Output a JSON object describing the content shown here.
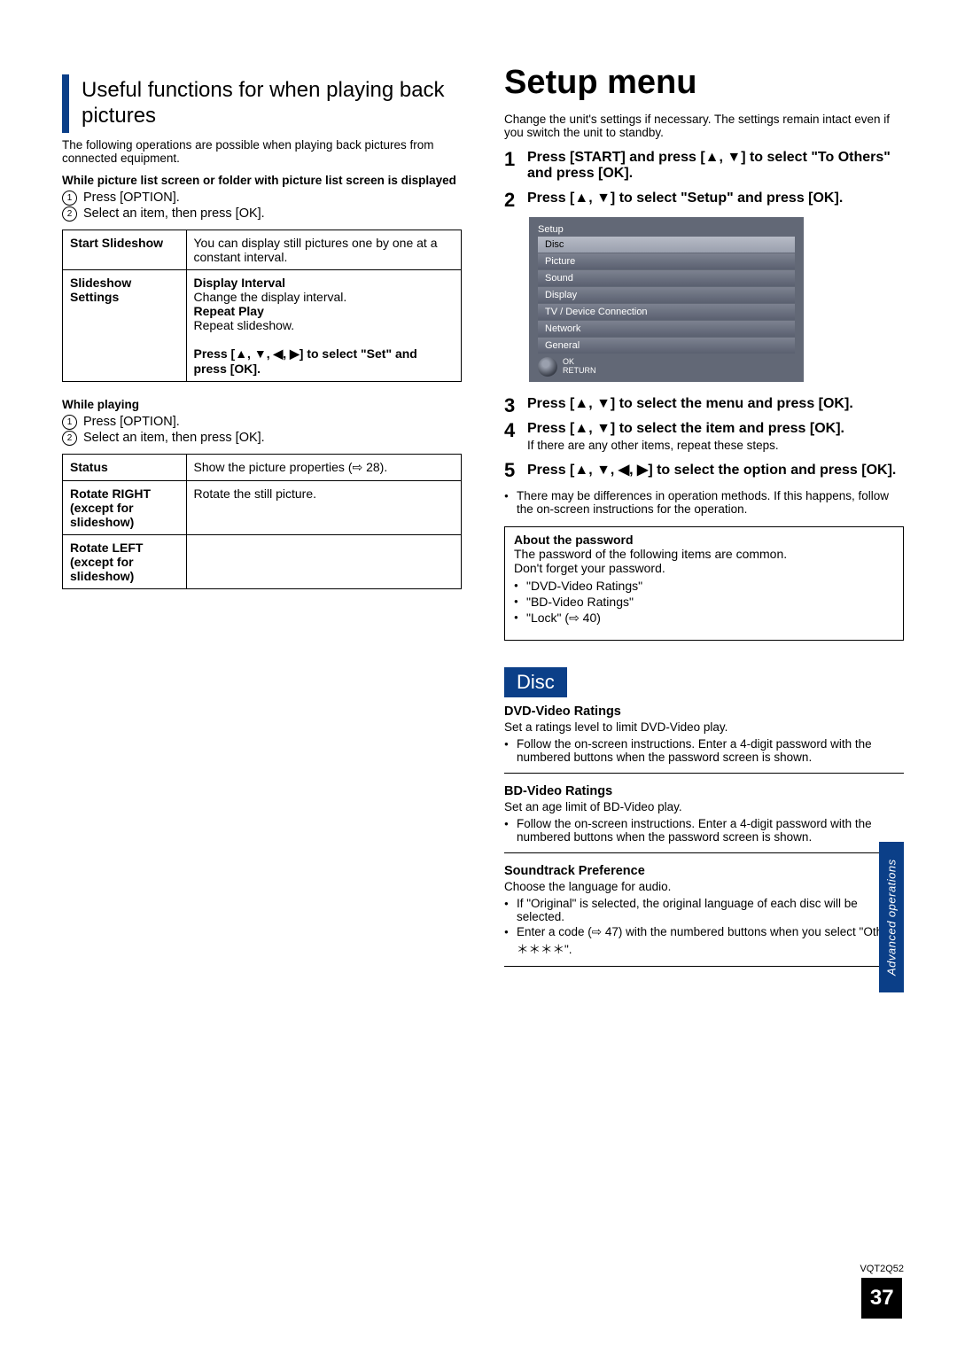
{
  "left": {
    "heading": "Useful functions for when playing back pictures",
    "intro": "The following operations are possible when playing back pictures from connected equipment.",
    "sub1_title": "While picture list screen or folder with picture list screen is displayed",
    "sub1_items": [
      "Press [OPTION].",
      "Select an item, then press [OK]."
    ],
    "table1": [
      {
        "h": "Start Slideshow",
        "d": "You can display still pictures one by one at a constant interval."
      },
      {
        "h": "Slideshow Settings",
        "d_html": "<b>Display Interval</b><br>Change the display interval.<br><b>Repeat Play</b><br>Repeat slideshow.<br><br><b>Press [▲, ▼, ◀, ▶] to select \"Set\" and press [OK].</b>"
      }
    ],
    "sub2_title": "While playing",
    "sub2_items": [
      "Press [OPTION].",
      "Select an item, then press [OK]."
    ],
    "table2": [
      {
        "h": "Status",
        "d": "Show the picture properties (⇨ 28)."
      },
      {
        "h": "Rotate RIGHT (except for slideshow)",
        "d": "Rotate the still picture."
      },
      {
        "h": "Rotate LEFT (except for slideshow)",
        "d": ""
      }
    ]
  },
  "right": {
    "heading": "Setup menu",
    "intro": "Change the unit's settings if necessary. The settings remain intact even if you switch the unit to standby.",
    "steps": [
      {
        "n": "1",
        "t": "Press [START] and press [▲, ▼] to select \"To Others\" and press [OK]."
      },
      {
        "n": "2",
        "t": "Press [▲, ▼] to select \"Setup\" and press [OK]."
      }
    ],
    "screen": {
      "title": "Setup",
      "items": [
        "Disc",
        "Picture",
        "Sound",
        "Display",
        "TV / Device Connection",
        "Network",
        "General"
      ],
      "selected_index": 0,
      "remote": {
        "ok": "OK",
        "return": "RETURN"
      }
    },
    "steps2": [
      {
        "n": "3",
        "t": "Press [▲, ▼] to select the menu and press [OK]."
      },
      {
        "n": "4",
        "t": "Press [▲, ▼] to select the item and press [OK].",
        "aux": "If there are any other items, repeat these steps."
      },
      {
        "n": "5",
        "t": "Press [▲, ▼, ◀, ▶] to select the option and press [OK]."
      }
    ],
    "note_bullets": [
      "There may be differences in operation methods. If this happens, follow the on-screen instructions for the operation."
    ],
    "password_box": {
      "title": "About the password",
      "lines": [
        "The password of the following items are common.",
        "Don't forget your password."
      ],
      "bullets": [
        "\"DVD-Video Ratings\"",
        "\"BD-Video Ratings\"",
        "\"Lock\" (⇨ 40)"
      ]
    },
    "disc_heading": "Disc",
    "disc_sections": [
      {
        "title": "DVD-Video Ratings",
        "line": "Set a ratings level to limit DVD-Video play.",
        "bullets": [
          "Follow the on-screen instructions. Enter a 4-digit password with the numbered buttons when the password screen is shown."
        ]
      },
      {
        "title": "BD-Video Ratings",
        "line": "Set an age limit of BD-Video play.",
        "bullets": [
          "Follow the on-screen instructions. Enter a 4-digit password with the numbered buttons when the password screen is shown."
        ]
      },
      {
        "title": "Soundtrack Preference",
        "line": "Choose the language for audio.",
        "bullets": [
          "If \"Original\" is selected, the original language of each disc will be selected.",
          "Enter a code (⇨ 47) with the numbered buttons when you select \"Other ＊＊＊＊\"."
        ]
      }
    ]
  },
  "side_tab": "Advanced operations",
  "footer": {
    "code": "VQT2Q52",
    "page": "37"
  }
}
